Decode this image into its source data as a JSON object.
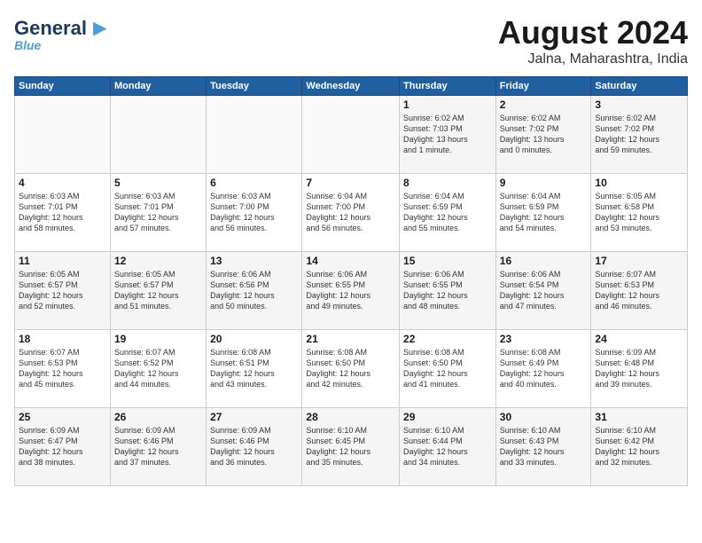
{
  "header": {
    "logo_line1": "General",
    "logo_line1_colored": "Blue",
    "logo_sub": "Blue",
    "month_title": "August 2024",
    "location": "Jalna, Maharashtra, India"
  },
  "weekdays": [
    "Sunday",
    "Monday",
    "Tuesday",
    "Wednesday",
    "Thursday",
    "Friday",
    "Saturday"
  ],
  "weeks": [
    [
      {
        "day": "",
        "info": ""
      },
      {
        "day": "",
        "info": ""
      },
      {
        "day": "",
        "info": ""
      },
      {
        "day": "",
        "info": ""
      },
      {
        "day": "1",
        "info": "Sunrise: 6:02 AM\nSunset: 7:03 PM\nDaylight: 13 hours\nand 1 minute."
      },
      {
        "day": "2",
        "info": "Sunrise: 6:02 AM\nSunset: 7:02 PM\nDaylight: 13 hours\nand 0 minutes."
      },
      {
        "day": "3",
        "info": "Sunrise: 6:02 AM\nSunset: 7:02 PM\nDaylight: 12 hours\nand 59 minutes."
      }
    ],
    [
      {
        "day": "4",
        "info": "Sunrise: 6:03 AM\nSunset: 7:01 PM\nDaylight: 12 hours\nand 58 minutes."
      },
      {
        "day": "5",
        "info": "Sunrise: 6:03 AM\nSunset: 7:01 PM\nDaylight: 12 hours\nand 57 minutes."
      },
      {
        "day": "6",
        "info": "Sunrise: 6:03 AM\nSunset: 7:00 PM\nDaylight: 12 hours\nand 56 minutes."
      },
      {
        "day": "7",
        "info": "Sunrise: 6:04 AM\nSunset: 7:00 PM\nDaylight: 12 hours\nand 56 minutes."
      },
      {
        "day": "8",
        "info": "Sunrise: 6:04 AM\nSunset: 6:59 PM\nDaylight: 12 hours\nand 55 minutes."
      },
      {
        "day": "9",
        "info": "Sunrise: 6:04 AM\nSunset: 6:59 PM\nDaylight: 12 hours\nand 54 minutes."
      },
      {
        "day": "10",
        "info": "Sunrise: 6:05 AM\nSunset: 6:58 PM\nDaylight: 12 hours\nand 53 minutes."
      }
    ],
    [
      {
        "day": "11",
        "info": "Sunrise: 6:05 AM\nSunset: 6:57 PM\nDaylight: 12 hours\nand 52 minutes."
      },
      {
        "day": "12",
        "info": "Sunrise: 6:05 AM\nSunset: 6:57 PM\nDaylight: 12 hours\nand 51 minutes."
      },
      {
        "day": "13",
        "info": "Sunrise: 6:06 AM\nSunset: 6:56 PM\nDaylight: 12 hours\nand 50 minutes."
      },
      {
        "day": "14",
        "info": "Sunrise: 6:06 AM\nSunset: 6:55 PM\nDaylight: 12 hours\nand 49 minutes."
      },
      {
        "day": "15",
        "info": "Sunrise: 6:06 AM\nSunset: 6:55 PM\nDaylight: 12 hours\nand 48 minutes."
      },
      {
        "day": "16",
        "info": "Sunrise: 6:06 AM\nSunset: 6:54 PM\nDaylight: 12 hours\nand 47 minutes."
      },
      {
        "day": "17",
        "info": "Sunrise: 6:07 AM\nSunset: 6:53 PM\nDaylight: 12 hours\nand 46 minutes."
      }
    ],
    [
      {
        "day": "18",
        "info": "Sunrise: 6:07 AM\nSunset: 6:53 PM\nDaylight: 12 hours\nand 45 minutes."
      },
      {
        "day": "19",
        "info": "Sunrise: 6:07 AM\nSunset: 6:52 PM\nDaylight: 12 hours\nand 44 minutes."
      },
      {
        "day": "20",
        "info": "Sunrise: 6:08 AM\nSunset: 6:51 PM\nDaylight: 12 hours\nand 43 minutes."
      },
      {
        "day": "21",
        "info": "Sunrise: 6:08 AM\nSunset: 6:50 PM\nDaylight: 12 hours\nand 42 minutes."
      },
      {
        "day": "22",
        "info": "Sunrise: 6:08 AM\nSunset: 6:50 PM\nDaylight: 12 hours\nand 41 minutes."
      },
      {
        "day": "23",
        "info": "Sunrise: 6:08 AM\nSunset: 6:49 PM\nDaylight: 12 hours\nand 40 minutes."
      },
      {
        "day": "24",
        "info": "Sunrise: 6:09 AM\nSunset: 6:48 PM\nDaylight: 12 hours\nand 39 minutes."
      }
    ],
    [
      {
        "day": "25",
        "info": "Sunrise: 6:09 AM\nSunset: 6:47 PM\nDaylight: 12 hours\nand 38 minutes."
      },
      {
        "day": "26",
        "info": "Sunrise: 6:09 AM\nSunset: 6:46 PM\nDaylight: 12 hours\nand 37 minutes."
      },
      {
        "day": "27",
        "info": "Sunrise: 6:09 AM\nSunset: 6:46 PM\nDaylight: 12 hours\nand 36 minutes."
      },
      {
        "day": "28",
        "info": "Sunrise: 6:10 AM\nSunset: 6:45 PM\nDaylight: 12 hours\nand 35 minutes."
      },
      {
        "day": "29",
        "info": "Sunrise: 6:10 AM\nSunset: 6:44 PM\nDaylight: 12 hours\nand 34 minutes."
      },
      {
        "day": "30",
        "info": "Sunrise: 6:10 AM\nSunset: 6:43 PM\nDaylight: 12 hours\nand 33 minutes."
      },
      {
        "day": "31",
        "info": "Sunrise: 6:10 AM\nSunset: 6:42 PM\nDaylight: 12 hours\nand 32 minutes."
      }
    ]
  ]
}
